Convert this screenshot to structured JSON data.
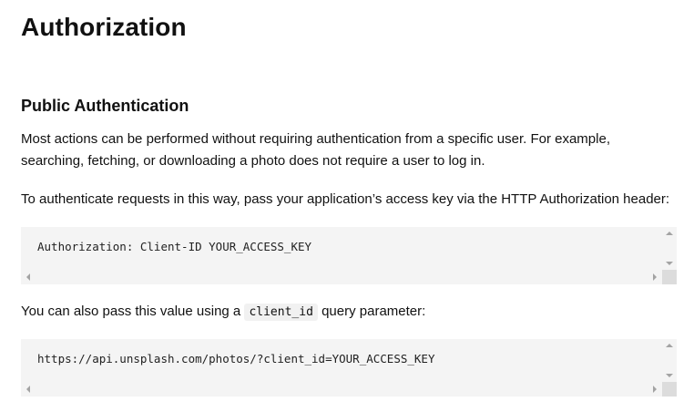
{
  "page": {
    "title": "Authorization",
    "section_title": "Public Authentication",
    "paragraph1": "Most actions can be performed without requiring authentication from a specific user. For example, searching, fetching, or downloading a photo does not require a user to log in.",
    "paragraph2": "To authenticate requests in this way, pass your application’s access key via the HTTP Authorization header:",
    "code_block1": "Authorization: Client-ID YOUR_ACCESS_KEY",
    "paragraph3_before": "You can also pass this value using a ",
    "paragraph3_code": "client_id",
    "paragraph3_after": " query parameter:",
    "code_block2": "https://api.unsplash.com/photos/?client_id=YOUR_ACCESS_KEY"
  },
  "icons": {
    "scroll_up": "scroll-up-arrow-icon",
    "scroll_down": "scroll-down-arrow-icon",
    "scroll_left": "scroll-left-arrow-icon",
    "scroll_right": "scroll-right-arrow-icon"
  },
  "colors": {
    "text": "#111111",
    "code_background": "#f4f4f4",
    "inline_code_background": "#f1f1f1",
    "scroll_corner": "#dcdcdc",
    "scroll_arrow": "#a3a3a3"
  }
}
